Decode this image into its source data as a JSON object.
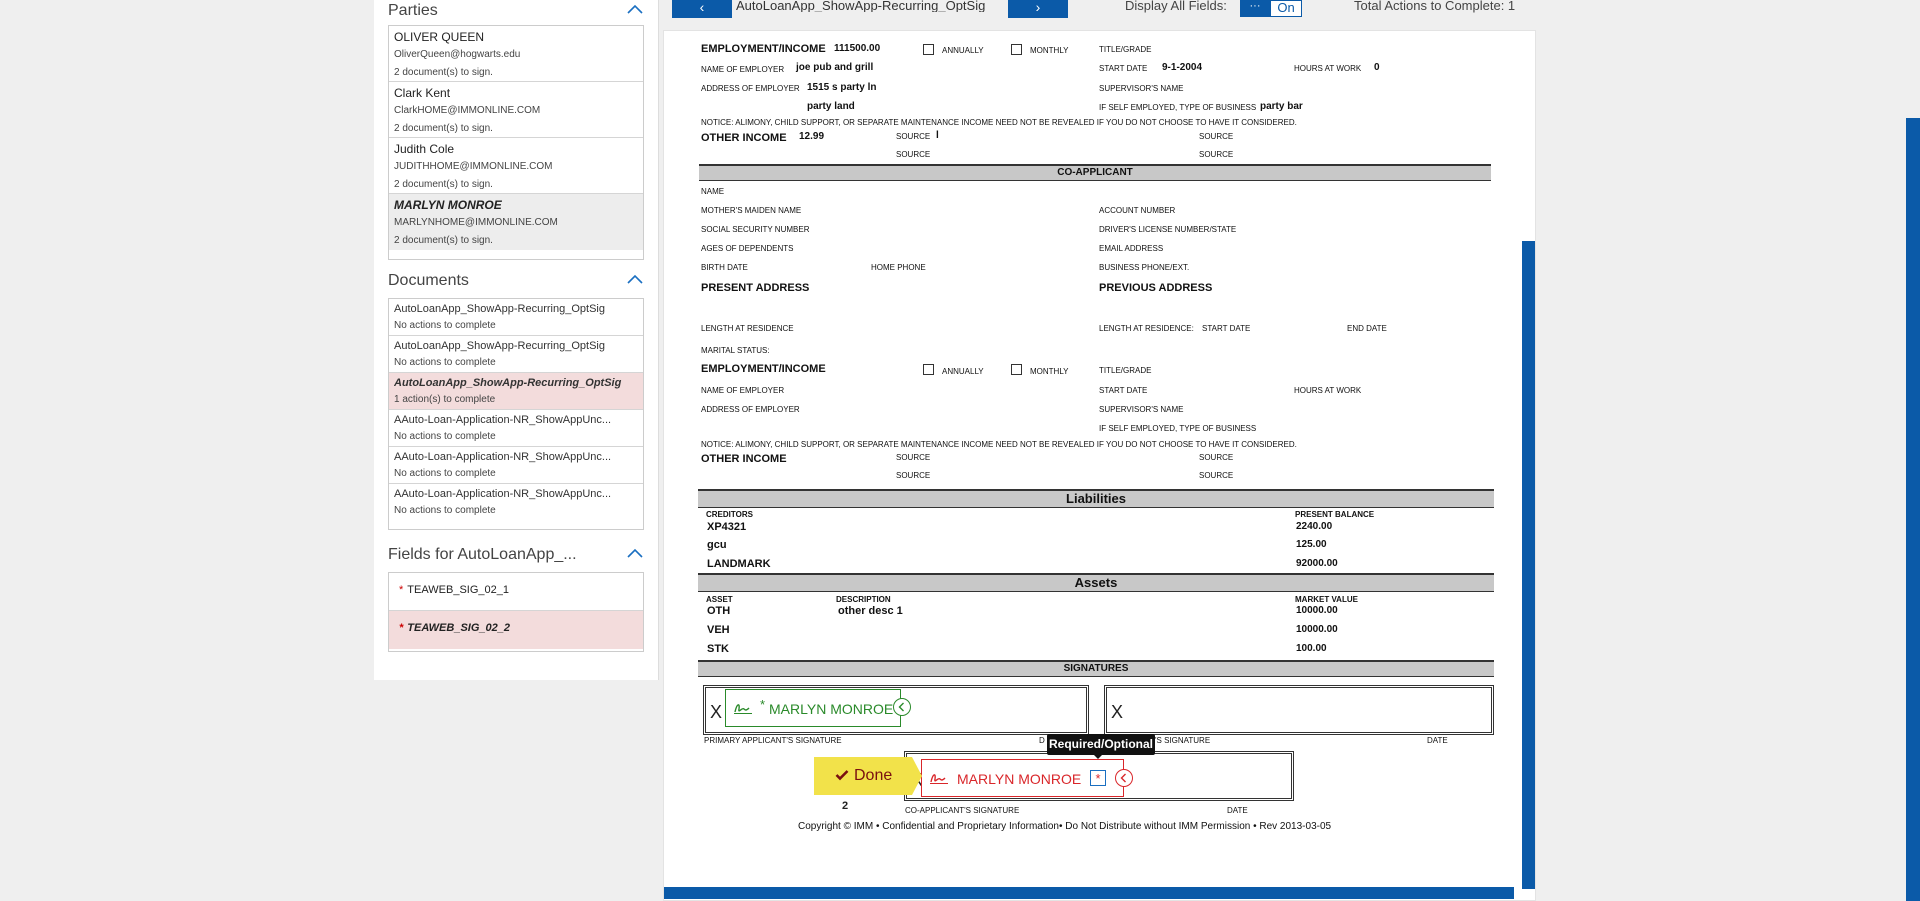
{
  "sidebar": {
    "parties_title": "Parties",
    "parties": [
      {
        "name": "OLIVER QUEEN",
        "email": "OliverQueen@hogwarts.edu",
        "count": "2 document(s) to sign."
      },
      {
        "name": "Clark Kent",
        "email": "ClarkHOME@IMMONLINE.COM",
        "count": "2 document(s) to sign."
      },
      {
        "name": "Judith Cole",
        "email": "JUDITHHOME@IMMONLINE.COM",
        "count": "2 document(s) to sign."
      },
      {
        "name": "MARLYN MONROE",
        "email": "MARLYNHOME@IMMONLINE.COM",
        "count": "2 document(s) to sign."
      }
    ],
    "documents_title": "Documents",
    "documents": [
      {
        "name": "AutoLoanApp_ShowApp-Recurring_OptSig",
        "status": "No actions to complete"
      },
      {
        "name": "AutoLoanApp_ShowApp-Recurring_OptSig",
        "status": "No actions to complete"
      },
      {
        "name": "AutoLoanApp_ShowApp-Recurring_OptSig",
        "status": "1 action(s) to complete"
      },
      {
        "name": "AAuto-Loan-Application-NR_ShowAppUnc...",
        "status": "No actions to complete"
      },
      {
        "name": "AAuto-Loan-Application-NR_ShowAppUnc...",
        "status": "No actions to complete"
      },
      {
        "name": "AAuto-Loan-Application-NR_ShowAppUnc...",
        "status": "No actions to complete"
      }
    ],
    "fields_title": "Fields for AutoLoanApp_...",
    "fields": [
      {
        "star": "*",
        "name": "TEAWEB_SIG_02_1"
      },
      {
        "star": "*",
        "name": "TEAWEB_SIG_02_2"
      }
    ]
  },
  "topbar": {
    "prev": "‹",
    "doc_name": "AutoLoanApp_ShowApp-Recurring_OptSig",
    "next": "›",
    "display_all_label": "Display All Fields:",
    "toggle_off": "···",
    "toggle_on": "On",
    "total_actions": "Total Actions to Complete: 1"
  },
  "document": {
    "employment_label": "EMPLOYMENT/INCOME",
    "employment_value": "111500.00",
    "annually": "ANNUALLY",
    "monthly": "MONTHLY",
    "title_grade": "TITLE/GRADE",
    "name_of_employer": "NAME OF EMPLOYER",
    "employer_value": "joe pub and grill",
    "start_date": "START DATE",
    "start_date_value": "9-1-2004",
    "hours_at_work": "HOURS AT WORK",
    "hours_value": "0",
    "address_of_employer": "ADDRESS OF EMPLOYER",
    "address_value_1": "1515 s party ln",
    "address_value_2": "party land",
    "supervisors_name": "SUPERVISOR'S NAME",
    "self_employed": "IF SELF EMPLOYED, TYPE OF BUSINESS",
    "business_value": "party bar",
    "notice": "NOTICE: ALIMONY, CHILD SUPPORT, OR SEPARATE MAINTENANCE INCOME NEED NOT BE REVEALED IF YOU DO NOT CHOOSE TO HAVE IT CONSIDERED.",
    "other_income": "OTHER INCOME",
    "other_income_value": "12.99",
    "source": "SOURCE",
    "source_value": "l",
    "co_applicant": "CO-APPLICANT",
    "name": "NAME",
    "maiden_name": "MOTHER'S MAIDEN NAME",
    "account_number": "ACCOUNT NUMBER",
    "ssn": "SOCIAL SECURITY NUMBER",
    "drivers_license": "DRIVER'S LICENSE NUMBER/STATE",
    "ages_dependents": "AGES OF DEPENDENTS",
    "email_address": "EMAIL ADDRESS",
    "birth_date": "BIRTH DATE",
    "home_phone": "HOME PHONE",
    "business_phone": "BUSINESS PHONE/EXT.",
    "present_address": "PRESENT ADDRESS",
    "previous_address": "PREVIOUS ADDRESS",
    "length_residence": "LENGTH AT RESIDENCE",
    "length_residence2": "LENGTH AT RESIDENCE:",
    "end_date": "END DATE",
    "marital_status": "MARITAL STATUS:",
    "liabilities": "Liabilities",
    "creditors": "CREDITORS",
    "present_balance": "PRESENT BALANCE",
    "liab_rows": [
      {
        "creditor": "XP4321",
        "balance": "2240.00"
      },
      {
        "creditor": "gcu",
        "balance": "125.00"
      },
      {
        "creditor": "LANDMARK",
        "balance": "92000.00"
      }
    ],
    "assets": "Assets",
    "asset": "ASSET",
    "description": "DESCRIPTION",
    "market_value": "MARKET VALUE",
    "asset_rows": [
      {
        "asset": "OTH",
        "desc": "other desc 1",
        "value": "10000.00"
      },
      {
        "asset": "VEH",
        "desc": "",
        "value": "10000.00"
      },
      {
        "asset": "STK",
        "desc": "",
        "value": "100.00"
      }
    ],
    "signatures": "SIGNATURES",
    "x_mark": "X",
    "primary_sig": "PRIMARY APPLICANT'S SIGNATURE",
    "d_partial": "D",
    "ant_sig": "ANT'S SIGNATURE",
    "date": "DATE",
    "co_sig": "CO-APPLICANT'S SIGNATURE",
    "copyright": "Copyright © IMM • Confidential and Proprietary Information• Do Not Distribute without IMM Permission • Rev 2013-03-05"
  },
  "sig_fields": {
    "primary_star": "*",
    "primary_name": "MARLYN MONROE",
    "co_name": "MARLYN MONROE",
    "co_star": "*",
    "tooltip": "Required/Optional",
    "done_label": "Done",
    "done_count": "2"
  },
  "colors": {
    "brand_blue": "#0b5aa8",
    "green": "#2a8a2a",
    "red": "#d9262a",
    "done_yellow": "#f2e24a"
  }
}
